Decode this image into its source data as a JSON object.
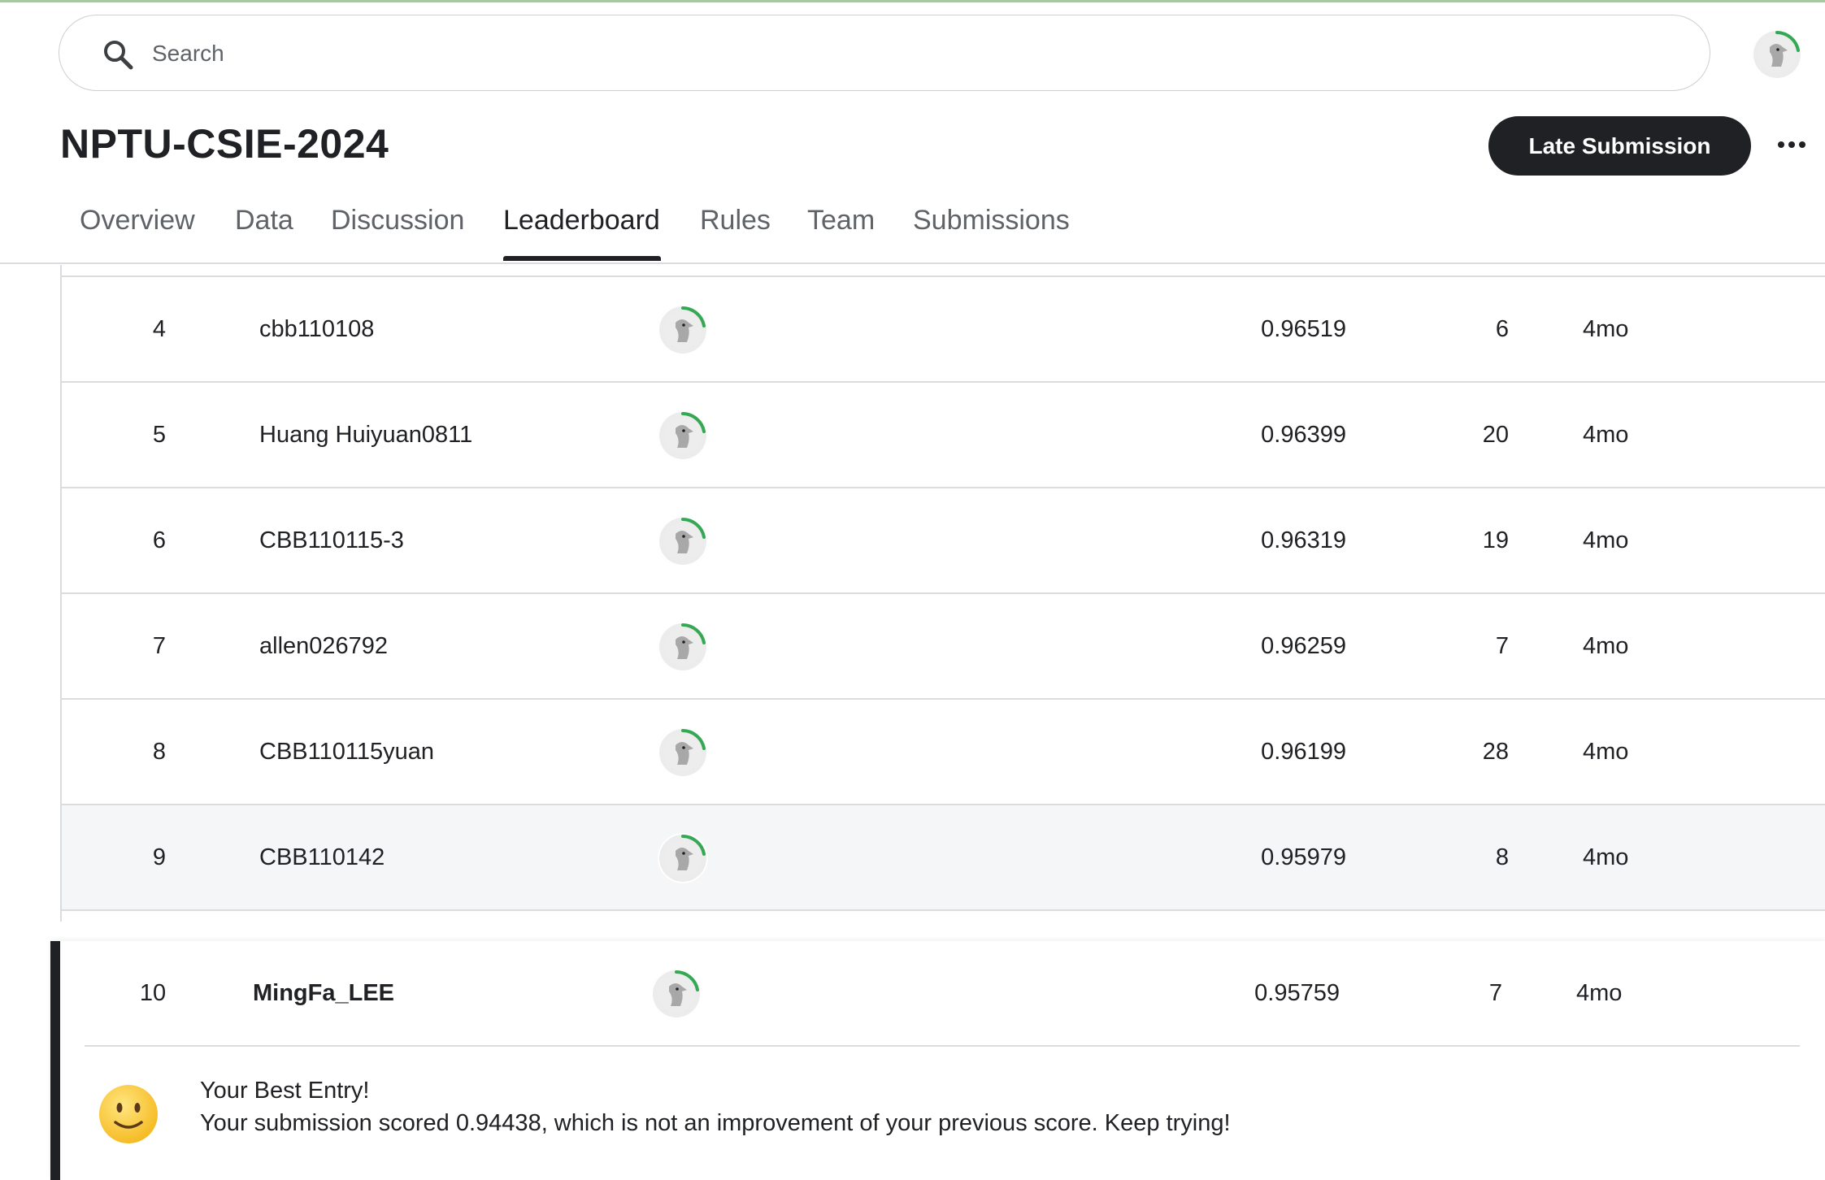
{
  "search": {
    "placeholder": "Search",
    "icon": "search-icon"
  },
  "header": {
    "title": "NPTU-CSIE-2024",
    "late_submission_label": "Late Submission",
    "more_icon": "more-horizontal-icon"
  },
  "tabs": [
    {
      "label": "Overview",
      "active": false
    },
    {
      "label": "Data",
      "active": false
    },
    {
      "label": "Discussion",
      "active": false
    },
    {
      "label": "Leaderboard",
      "active": true
    },
    {
      "label": "Rules",
      "active": false
    },
    {
      "label": "Team",
      "active": false
    },
    {
      "label": "Submissions",
      "active": false
    }
  ],
  "leaderboard": {
    "rows": [
      {
        "rank": "4",
        "team": "cbb110108",
        "score": "0.96519",
        "entries": "6",
        "last": "4mo"
      },
      {
        "rank": "5",
        "team": "Huang Huiyuan0811",
        "score": "0.96399",
        "entries": "20",
        "last": "4mo"
      },
      {
        "rank": "6",
        "team": "CBB110115-3",
        "score": "0.96319",
        "entries": "19",
        "last": "4mo"
      },
      {
        "rank": "7",
        "team": "allen026792",
        "score": "0.96259",
        "entries": "7",
        "last": "4mo"
      },
      {
        "rank": "8",
        "team": "CBB110115yuan",
        "score": "0.96199",
        "entries": "28",
        "last": "4mo"
      },
      {
        "rank": "9",
        "team": "CBB110142",
        "score": "0.95979",
        "entries": "8",
        "last": "4mo"
      }
    ],
    "my_entry": {
      "rank": "10",
      "team": "MingFa_LEE",
      "score": "0.95759",
      "entries": "7",
      "last": "4mo"
    }
  },
  "message": {
    "title": "Your Best Entry!",
    "body": "Your submission scored 0.94438, which is not an improvement of your previous score. Keep trying!",
    "icon": "smiling-face-emoji"
  },
  "colors": {
    "accent_dark": "#202124",
    "progress_ring": "#34a853",
    "divider": "#dadce0"
  }
}
